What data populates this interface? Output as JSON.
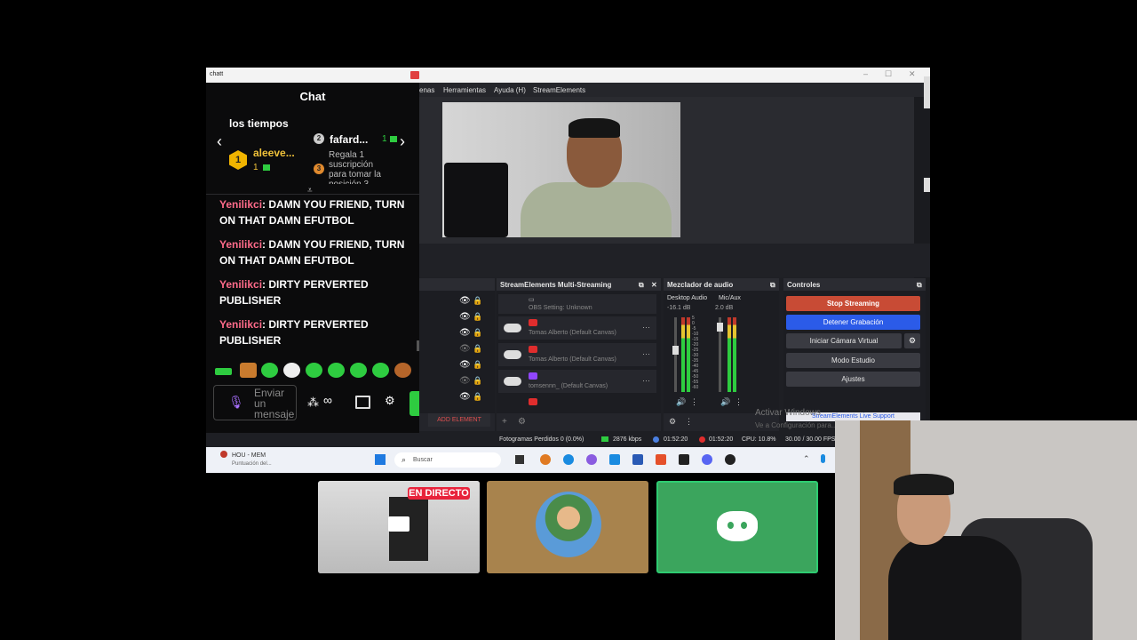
{
  "window": {
    "title": "chatt",
    "min": "–",
    "max": "☐",
    "close": "✕"
  },
  "chat": {
    "header": "Chat",
    "leaderboard_label": "los tiempos",
    "leaders": [
      {
        "rank": "1",
        "name": "aleeve...",
        "count": "1"
      },
      {
        "rank": "2",
        "name": "fafard...",
        "count": "1"
      },
      {
        "rank": "3",
        "text": "Regala 1 suscripción para tomar la posición 3"
      }
    ],
    "messages": [
      {
        "user": "Yenilikci",
        "text": ": DAMN YOU FRIEND, TURN ON THAT DAMN EFUTBOL"
      },
      {
        "user": "Yenilikci",
        "text": ": DAMN YOU FRIEND, TURN ON THAT DAMN EFUTBOL"
      },
      {
        "user": "Yenilikci",
        "text": ": DIRTY PERVERTED PUBLISHER"
      },
      {
        "user": "Yenilikci",
        "text": ": DIRTY PERVERTED PUBLISHER"
      }
    ],
    "input_placeholder": "Enviar un mensaje",
    "points": "∞"
  },
  "obs": {
    "menu": [
      "enas",
      "Herramientas",
      "Ayuda (H)",
      "StreamElements"
    ],
    "multistream": {
      "title": "StreamElements Multi-Streaming",
      "rows": [
        "OBS Setting: Unknown",
        "Tomas Alberto (Default Canvas)",
        "Tomas Alberto (Default Canvas)",
        "tomsennn_ (Default Canvas)"
      ],
      "add": "ADD ELEMENT"
    },
    "mixer": {
      "title": "Mezclador de audio",
      "ch1": "Desktop Audio",
      "ch1_db": "-16.1 dB",
      "ch2": "Mic/Aux",
      "ch2_db": "2.0 dB",
      "scale": [
        "5",
        "0",
        "-5",
        "-10",
        "-15",
        "-20",
        "-25",
        "-30",
        "-35",
        "-40",
        "-45",
        "-50",
        "-55",
        "-60"
      ]
    },
    "controls": {
      "title": "Controles",
      "stop_streaming": "Stop Streaming",
      "stop_recording": "Detener Grabación",
      "virtual_cam": "Iniciar Cámara Virtual",
      "studio": "Modo Estudio",
      "settings": "Ajustes",
      "support": "StreamElements Live Support"
    },
    "watermark": "Activar Windows",
    "watermark2": "Ve a Configuración para...",
    "status": {
      "dropped": "Fotogramas Perdidos 0 (0.0%)",
      "kbps": "2876 kbps",
      "stream_time": "01:52:20",
      "rec_time": "01:52:20",
      "cpu": "CPU: 10.8%",
      "fps": "30.00 / 30.00 FPS"
    }
  },
  "taskbar": {
    "weather_title": "HOU - MEM",
    "weather_sub": "Puntuación del...",
    "search": "Buscar"
  },
  "tiles": {
    "live_badge": "EN DIRECTO"
  },
  "colors": {
    "stop": "#c0392b",
    "record": "#2b5be8",
    "discord": "#3ba55d",
    "tile_gold": "#a8834d"
  }
}
